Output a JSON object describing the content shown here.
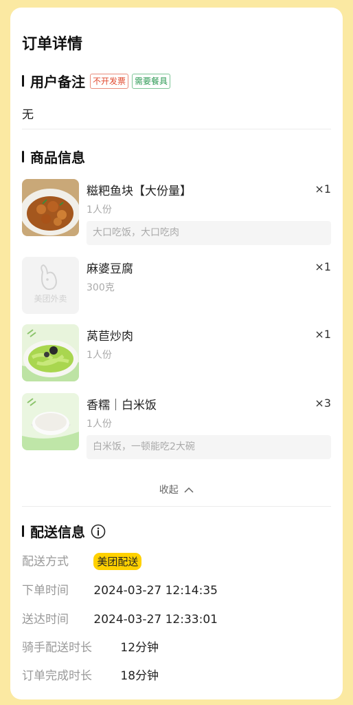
{
  "page_title": "订单详情",
  "remark_section": {
    "title": "用户备注",
    "tags": [
      "不开发票",
      "需要餐具"
    ],
    "content": "无"
  },
  "goods_section": {
    "title": "商品信息",
    "items": [
      {
        "name": "糍粑鱼块【大份量】",
        "qty": "×1",
        "spec": "1人份",
        "note": "大口吃饭，大口吃肉",
        "thumb_icon": "braised-fish-photo"
      },
      {
        "name": "麻婆豆腐",
        "qty": "×1",
        "spec": "300克",
        "note": "",
        "thumb_icon": "meituan-waimai-placeholder-icon",
        "placeholder_text": "美团外卖"
      },
      {
        "name": "莴苣炒肉",
        "qty": "×1",
        "spec": "1人份",
        "note": "",
        "thumb_icon": "stir-fried-lettuce-photo"
      },
      {
        "name": "香糯｜白米饭",
        "qty": "×3",
        "spec": "1人份",
        "note": "白米饭，一顿能吃2大碗",
        "thumb_icon": "white-rice-photo"
      }
    ],
    "collapse_label": "收起"
  },
  "delivery_section": {
    "title": "配送信息",
    "rows": [
      {
        "label": "配送方式",
        "value": "美团配送"
      },
      {
        "label": "下单时间",
        "value": "2024-03-27 12:14:35"
      },
      {
        "label": "送达时间",
        "value": "2024-03-27 12:33:01"
      },
      {
        "label": "骑手配送时长",
        "value": "12分钟"
      },
      {
        "label": "订单完成时长",
        "value": "18分钟"
      }
    ]
  },
  "colors": {
    "background": "#fbe9a2",
    "badge_yellow": "#ffd100",
    "tag_red": "#e04a2f",
    "tag_green": "#2e9a55"
  }
}
